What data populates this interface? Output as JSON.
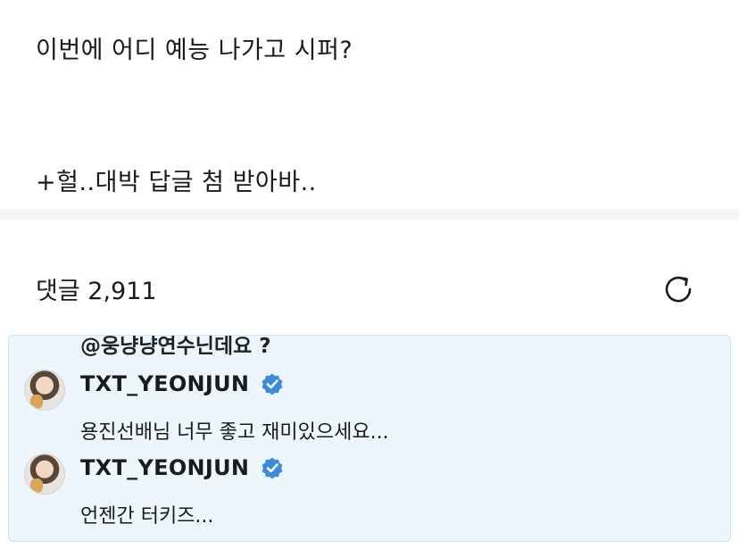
{
  "post": {
    "line1": "이번에 어디 예능 나가고 시퍼?",
    "line2": "+헐..대박 답글 첨 받아바.."
  },
  "comments_section": {
    "title": "댓글 2,911",
    "refresh_icon": "refresh-icon"
  },
  "comment_card": {
    "mention": "@웅냥냥연수닌데요 ?",
    "items": [
      {
        "username": "TXT_YEONJUN",
        "verified": true,
        "text": "용진선배님 너무 좋고 재미있으세요..."
      },
      {
        "username": "TXT_YEONJUN",
        "verified": true,
        "text": "언젠간 터키즈..."
      }
    ]
  },
  "colors": {
    "card_bg": "#eef6fd",
    "card_border": "#c9e2f6",
    "verified_blue": "#3a8bd9",
    "divider": "#f3f4f6"
  }
}
